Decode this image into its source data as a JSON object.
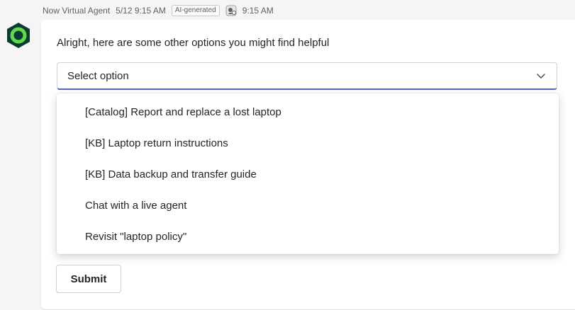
{
  "meta": {
    "sender": "Now Virtual Agent",
    "timestamp": "5/12 9:15 AM",
    "badge": "AI-generated",
    "seen_time": "9:15 AM"
  },
  "avatar": {
    "icon": "now-virtual-agent-logo",
    "colors": {
      "outer": "#0b3a2e",
      "inner": "#62d84e"
    }
  },
  "message": {
    "text": "Alright, here are some other options you might find helpful"
  },
  "select": {
    "placeholder": "Select option",
    "icon": "chevron-down-icon",
    "options": [
      "[Catalog] Report and replace a lost laptop",
      "[KB] Laptop return instructions",
      "[KB] Data backup and transfer guide",
      "Chat with a live agent",
      "Revisit \"laptop policy\""
    ]
  },
  "submit": {
    "label": "Submit"
  },
  "colors": {
    "accent": "#5b5fc7",
    "card_bg": "#ffffff",
    "page_bg": "#f5f5f5"
  }
}
